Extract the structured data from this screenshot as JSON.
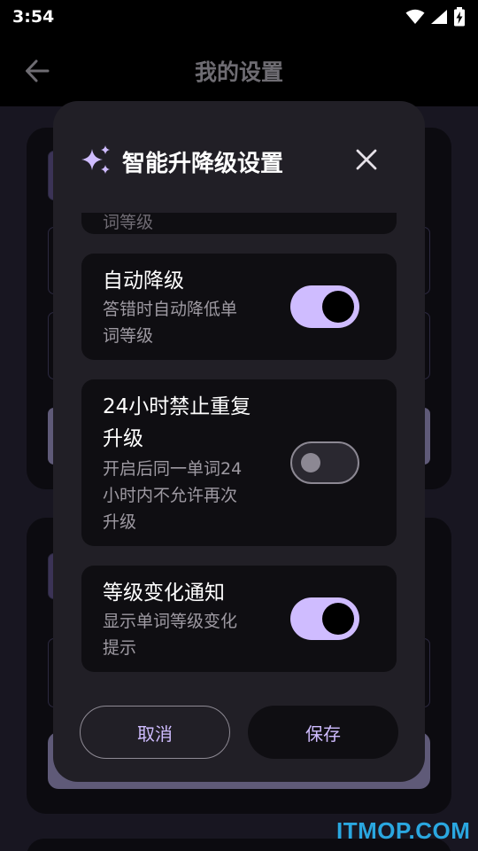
{
  "status_bar": {
    "time": "3:54"
  },
  "app_bar": {
    "title": "我的设置",
    "back_icon": "arrow-left-icon"
  },
  "dialog": {
    "title": "智能升降级设置",
    "title_icon": "sparkle-icon",
    "close_icon": "close-icon",
    "partial_prev_text": "词等级",
    "settings": [
      {
        "title": "自动降级",
        "desc_lines": [
          "答错时自动降低单",
          "词等级"
        ],
        "enabled": true
      },
      {
        "title_lines": [
          "24小时禁止重复",
          "升级"
        ],
        "desc_lines": [
          "开启后同一单词24",
          "小时内不允许再次",
          "升级"
        ],
        "enabled": false
      },
      {
        "title": "等级变化通知",
        "desc_lines": [
          "显示单词等级变化",
          "提示"
        ],
        "enabled": true
      }
    ],
    "cancel_label": "取消",
    "save_label": "保存"
  },
  "watermark": "ITMOP.COM",
  "colors": {
    "accent": "#cfbcff",
    "dialog_bg": "#211f26",
    "card_bg": "#0f0e12",
    "watermark": "#2aa7e0"
  }
}
